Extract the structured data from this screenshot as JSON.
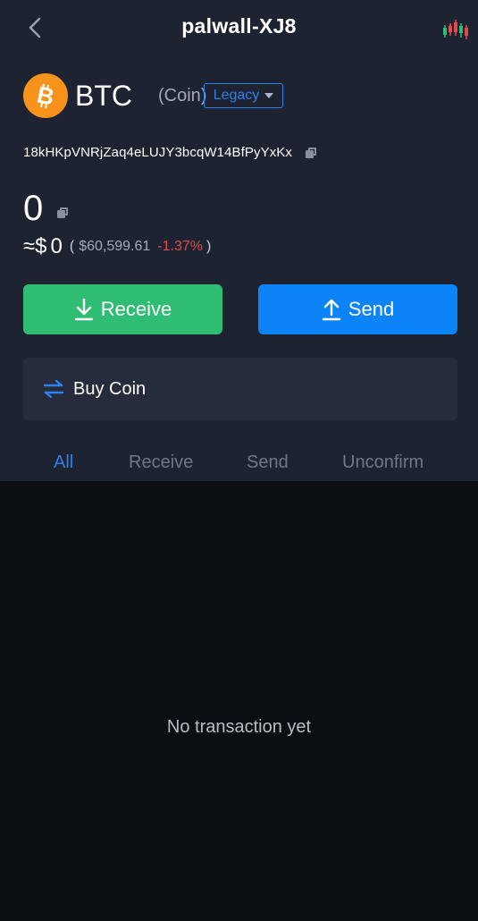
{
  "header": {
    "title": "palwall-XJ8",
    "back_icon": "chevron-left-icon",
    "chart_icon": "candlestick-chart-icon"
  },
  "coin": {
    "logo_icon": "bitcoin-logo-icon",
    "symbol": "BTC",
    "type": "(Coin)",
    "address_type": "Legacy",
    "address": "18kHKpVNRjZaq4eLUJY3bcqW14BfPyYxKx"
  },
  "balance": {
    "amount": "0",
    "fiat_approx": "≈$",
    "fiat_value": "0",
    "open_paren": "(",
    "price": "$60,599.61",
    "change": "-1.37%",
    "close_paren": ")"
  },
  "actions": {
    "receive_label": "Receive",
    "send_label": "Send",
    "buy_coin_label": "Buy Coin"
  },
  "tabs": [
    {
      "label": "All",
      "active": true
    },
    {
      "label": "Receive",
      "active": false
    },
    {
      "label": "Send",
      "active": false
    },
    {
      "label": "Unconfirm",
      "active": false
    }
  ],
  "transactions": {
    "empty_message": "No transaction yet"
  },
  "colors": {
    "background": "#0b0e12",
    "panel": "#1e2332",
    "accent": "#2f80ed",
    "receive": "#2ebd73",
    "send": "#0c84f7",
    "negative": "#e5484d",
    "bitcoin": "#f7931a"
  }
}
